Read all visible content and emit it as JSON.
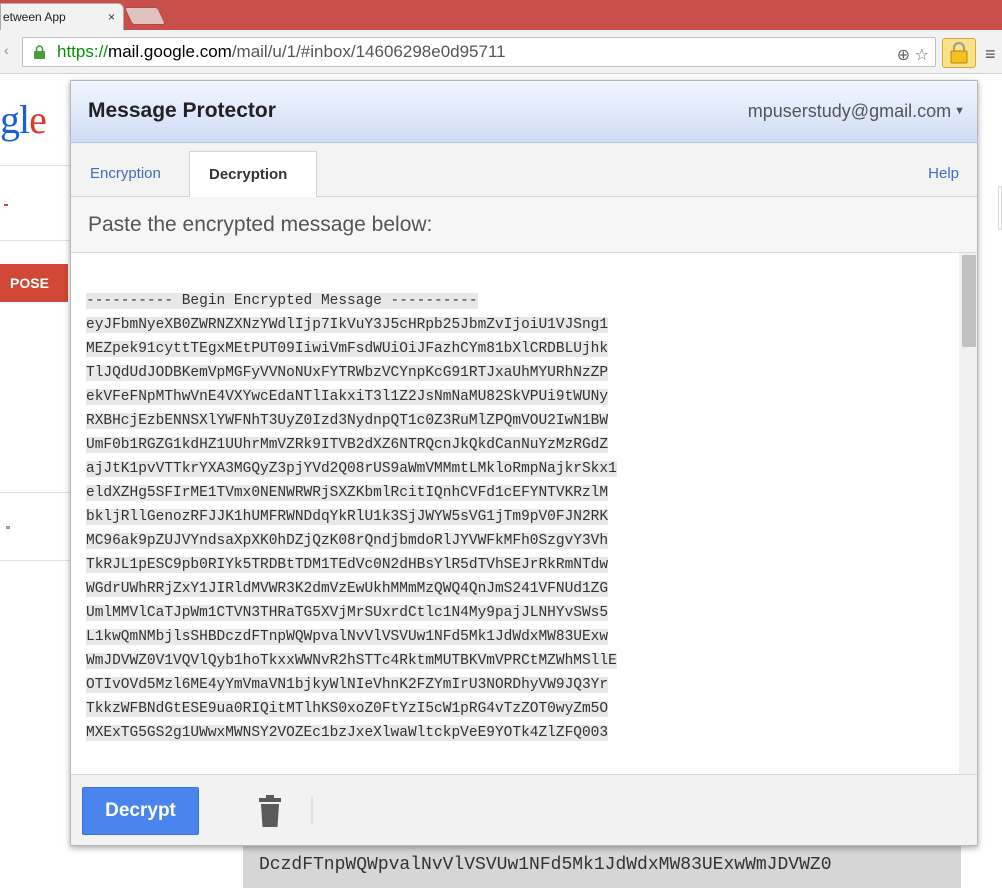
{
  "browser": {
    "tab_title": "etween App",
    "tab_close": "×",
    "url_scheme": "https://",
    "url_host": "mail.google.com",
    "url_path": "/mail/u/1/#inbox/14606298e0d95711",
    "omnibox_icons": "⊕ ☆",
    "menu_icon": "≡"
  },
  "gmail": {
    "logo_text": "gl",
    "logo_e": "e",
    "compose_label": "POSE",
    "background_line": "DczdFTnpWQWpvalNvVlVSVUw1NFd5Mk1JdWdxMW83UExwWmJDVWZ0"
  },
  "popup": {
    "title": "Message Protector",
    "account": "mpuserstudy@gmail.com",
    "tabs": [
      {
        "label": "Encryption",
        "active": false
      },
      {
        "label": "Decryption",
        "active": true
      }
    ],
    "help_label": "Help",
    "instruction": "Paste the encrypted message below:",
    "message_lines": [
      "---------- Begin Encrypted Message ----------",
      "eyJFbmNyeXB0ZWRNZXNzYWdlIjp7IkVuY3J5cHRpb25JbmZvIjoiU1VJSng1",
      "MEZpek91cyttTEgxMEtPUT09IiwiVmFsdWUiOiJFazhCYm81bXlCRDBLUjhk",
      "TlJQdUdJODBKemVpMGFyVVNoNUxFYTRWbzVCYnpKcG91RTJxaUhMYURhNzZP",
      "ekVFeFNpMThwVnE4VXYwcEdaNTlIakxiT3l1Z2JsNmNaMU82SkVPUi9tWUNy",
      "RXBHcjEzbENNSXlYWFNhT3UyZ0Izd3NydnpQT1c0Z3RuMlZPQmVOU2IwN1BW",
      "UmF0b1RGZG1kdHZ1UUhrMmVZRk9ITVB2dXZ6NTRQcnJkQkdCanNuYzMzRGdZ",
      "ajJtK1pvVTTkrYXA3MGQyZ3pjYVd2Q08rUS9aWmVMMmtLMkloRmpNajkrSkx1",
      "eldXZHg5SFIrME1TVmx0NENWRWRjSXZKbmlRcitIQnhCVFd1cEFYNTVKRzlM",
      "bkljRllGenozRFJJK1hUMFRWNDdqYkRlU1k3SjJWYW5sVG1jTm9pV0FJN2RK",
      "MC96ak9pZUJVYndsaXpXK0hDZjQzK08rQndjbmdoRlJYVWFkMFh0SzgvY3Vh",
      "TkRJL1pESC9pb0RIYk5TRDBtTDM1TEdVc0N2dHBsYlR5dTVhSEJrRkRmNTdw",
      "WGdrUWhRRjZxY1JIRldMVWR3K2dmVzEwUkhMMmMzQWQ4QnJmS241VFNUd1ZG",
      "UmlMMVlCaTJpWm1CTVN3THRaTG5XVjMrSUxrdCtlc1N4My9pajJLNHYvSWs5",
      "L1kwQmNMbjlsSHBDczdFTnpWQWpvalNvVlVSVUw1NFd5Mk1JdWdxMW83UExw",
      "WmJDVWZ0V1VQVlQyb1hoTkxxWWNvR2hSTTc4RktmMUTBKVmVPRCtMZWhMSllE",
      "OTIvOVd5Mzl6ME4yYmVmaVN1bjkyWlNIeVhnK2FZYmIrU3NORDhyVW9JQ3Yr",
      "TkkzWFBNdGtESE9ua0RIQitMTlhKS0xoZ0FtYzI5cW1pRG4vTzZOT0wyZm5O",
      "MXExTG5GS2g1UWwxMWNSY2VOZEc1bzJxeXlwaWltckpVeE9YOTk4ZlZFQ003"
    ],
    "decrypt_label": "Decrypt",
    "trash_icon": "trash-icon"
  },
  "colors": {
    "tabstrip": "#c9504a",
    "link_blue": "#3c6fc2",
    "decrypt_button": "#4a85ee",
    "compose_red": "#d14836",
    "https_green": "#0a8f08"
  }
}
